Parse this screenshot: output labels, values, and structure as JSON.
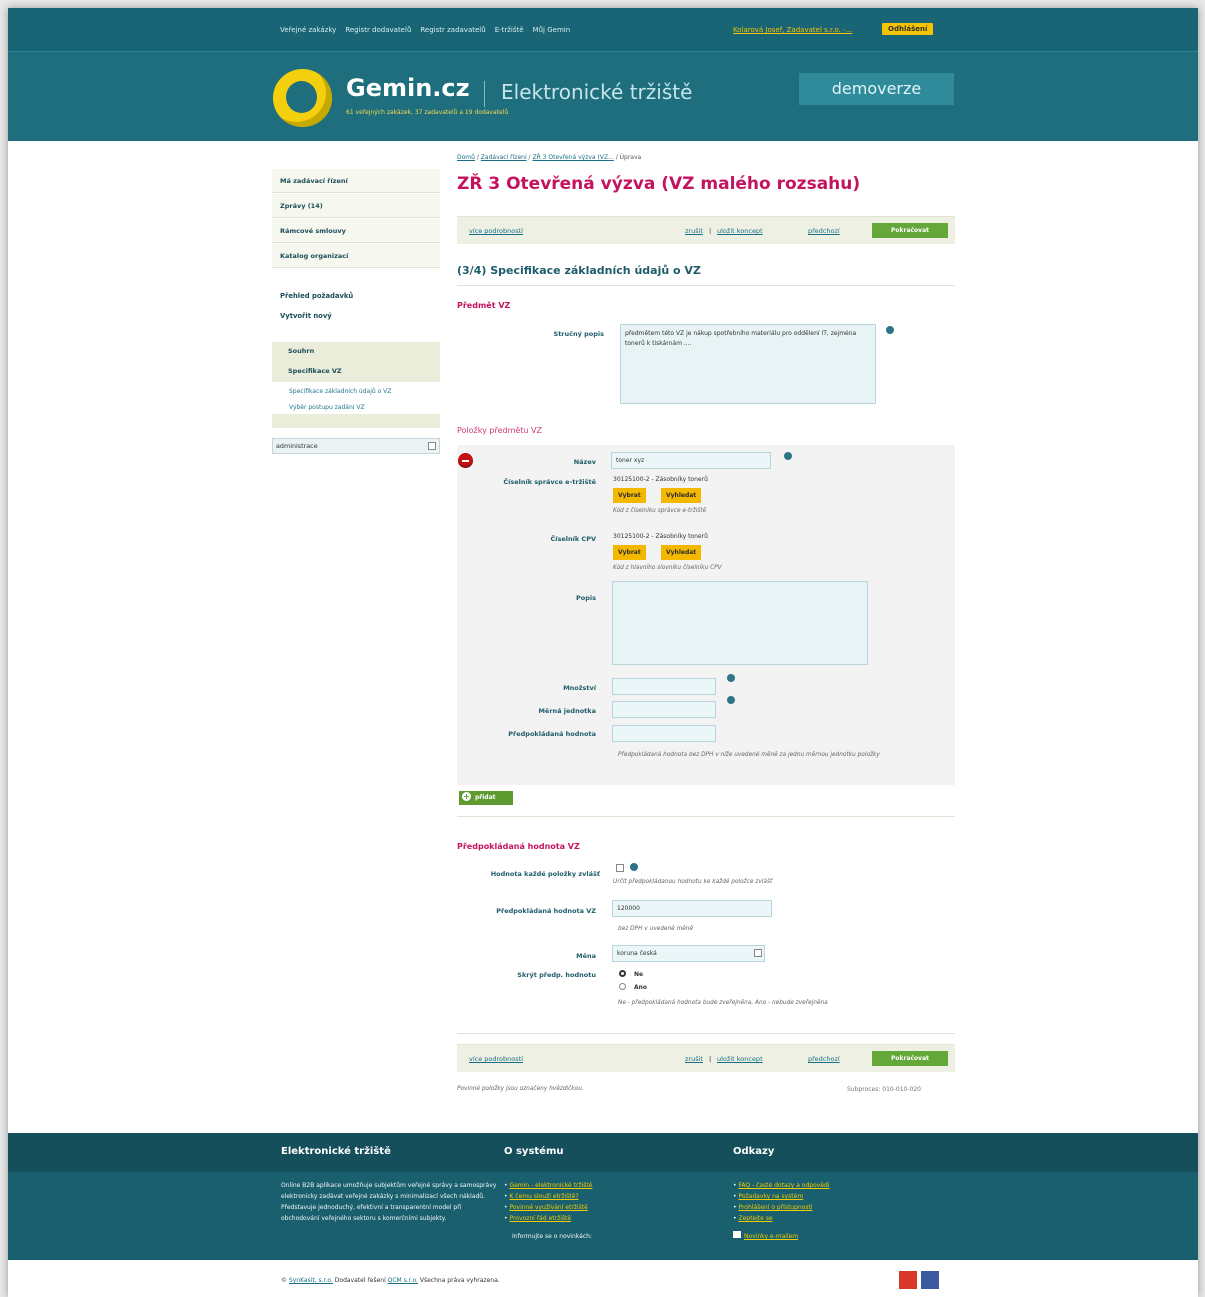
{
  "topnav": {
    "items": [
      "Veřejné zakázky",
      "Registr dodavatelů",
      "Registr zadavatelů",
      "E-tržiště",
      "Můj Gemin"
    ],
    "user": "Kolarová Josef, Zadavatel s.r.o. -...",
    "logout": "Odhlášení"
  },
  "brand": {
    "name": "Gemin.cz",
    "subtitle": "Elektronické tržiště",
    "stats": "61 veřejných zakázek, 37 zadavatelů a 19 dodavatelů",
    "demo": "demoverze"
  },
  "sidebar": {
    "boxes": [
      "Má zadávací řízení",
      "Zprávy (14)",
      "Rámcové smlouvy",
      "Katalog organizací"
    ],
    "links": [
      "Přehled požadavků",
      "Vytvořit nový"
    ],
    "steps": [
      "Souhrn",
      "Specifikace VZ"
    ],
    "substeps": [
      "Specifikace základních údajů o VZ",
      "Výběr postupu zadání VZ"
    ],
    "admin": "administrace"
  },
  "main": {
    "breadcrumb": [
      "Domů",
      "Zadávací řízení",
      "ZŘ 3 Otevřená výzva (VZ...",
      "Úprava"
    ],
    "title": "ZŘ 3 Otevřená výzva (VZ malého rozsahu)",
    "more": "více podrobností",
    "cancel": "zrušit",
    "save": "uložit koncept",
    "prev": "předchozí",
    "continue": "Pokračovat",
    "heading": "(3/4) Specifikace základních údajů o VZ",
    "subject": "Předmět VZ",
    "short_label": "Stručný popis",
    "short_value": "předmětem této VZ je nákup spotřebního materiálu pro oddělení IT, zejména tonerů k tiskárnám ....",
    "items_title": "Položky předmětu VZ",
    "name_label": "Název",
    "name_value": "toner xyz",
    "admin_code_label": "Číselník správce e-tržiště",
    "admin_code_value": "30125100-2 - Zásobníky tonerů",
    "cpv_label": "Číselník CPV",
    "cpv_value": "30125100-2 - Zásobníky tonerů",
    "choose": "Vybrat",
    "search": "Vyhledat",
    "admin_hint": "Kód z číselníku správce e-tržiště",
    "cpv_hint": "Kód z hlavního slovníku číselníku CPV",
    "desc_label": "Popis",
    "qty_label": "Množství",
    "unit_label": "Měrná jednotka",
    "expected_label": "Předpokládaná hodnota",
    "expected_hint": "Předpokládaná hodnota bez DPH v níže uvedené měně za jednu měrnou jednotku položky",
    "add": "přidat",
    "value_title": "Předpokládaná hodnota VZ",
    "each_label": "Hodnota každé položky zvlášť",
    "each_hint": "Určit předpokládanou hodnotu ke každé položce zvlášť",
    "vz_value_label": "Předpokládaná hodnota VZ",
    "vz_value": "120000",
    "vat_hint": "bez DPH v uvedené měně",
    "currency_label": "Měna",
    "currency": "koruna česká",
    "hide_label": "Skrýt předp. hodnotu",
    "hide_no": "Ne",
    "hide_yes": "Ano",
    "hide_hint": "Ne - předpokládaná hodnota bude zveřejněna, Ano - nebude zveřejněna",
    "required_note": "Povinné položky jsou označeny hvězdičkou.",
    "subprocess": "Subproces: 010-010-020"
  },
  "footer": {
    "col1_title": "Elektronické tržiště",
    "col1_text": "Online B2B aplikace umožňuje subjektům veřejné správy a samosprávy elektronicky zadávat veřejné zakázky s minimalizací všech nákladů. Představuje jednoduchý, efektivní a transparentní model při obchodování veřejného sektoru s komerčními subjekty.",
    "col2_title": "O systému",
    "col2_links": [
      "Gemin - elektronické tržiště",
      "K čemu slouží etržiště?",
      "Povinné využívání etržiště",
      "Provozní řád etržiště"
    ],
    "newsletter": "Informujte se o novinkách:",
    "col3_title": "Odkazy",
    "col3_links": [
      "FAQ - časté dotazy a odpovědi",
      "Požadavky na systém",
      "Prohlášení o přístupnosti",
      "Zeptejte se"
    ],
    "news_link": "Novinky e-mailem",
    "copyright1": "© ",
    "copyright_link1": "SynKasit, s.r.o.",
    "copyright2": " Dodavatel řešení ",
    "copyright_link2": "QCM s.r.o.",
    "copyright3": " Všechna práva vyhrazena."
  },
  "colors": {
    "teal": "#1e6e7e",
    "pink": "#c4145f",
    "yellow": "#f5c400",
    "green": "#64a83a"
  }
}
